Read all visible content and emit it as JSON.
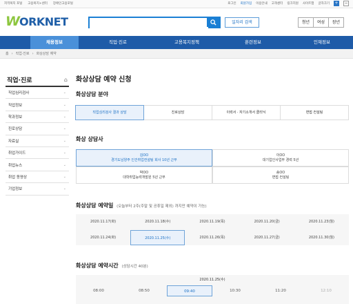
{
  "topbar": {
    "left_links": [
      "지역복지 포털",
      "고용복지+센터",
      "장애인고용포털"
    ],
    "right_links": [
      "로그인",
      "회원가입",
      "이용안내",
      "고객센터",
      "링크지원",
      "사이트맵",
      "글자크기"
    ],
    "zoom_plus": "+",
    "zoom_minus": "−"
  },
  "header": {
    "logo_w": "W",
    "logo_rest": "ORKNET",
    "search_placeholder": "",
    "job_search_label": "일자리 검색",
    "target_buttons": [
      "청년",
      "여성",
      "장년"
    ]
  },
  "gnb": {
    "items": [
      "채용정보",
      "직업·진로",
      "고용복지정책",
      "훈련정보",
      "인재정보"
    ],
    "active_index": 0
  },
  "breadcrumb": {
    "home": "홈",
    "items": [
      "직업·진로",
      "화상상담 예약"
    ]
  },
  "sidebar": {
    "title": "직업·진로",
    "items": [
      "직업심리검사",
      "직업정보",
      "학과정보",
      "진로상담",
      "자료실",
      "취업가이드",
      "취업뉴스",
      "취업 동영상",
      "기업정보"
    ]
  },
  "main": {
    "page_title": "화상상담 예약 신청",
    "field_section": {
      "title": "화상상담 분야",
      "categories": [
        "직업심리검사 결과 상담",
        "진로상담",
        "이력서 · 자기소개서 클리닉",
        "면접 컨설팅"
      ],
      "selected_index": 0
    },
    "counselor_section": {
      "title": "화상 상담사",
      "counselors": [
        {
          "name": "김OO",
          "desc": "경기도남양주 인건취업컨설팅 회사 10년 근무",
          "selected": true
        },
        {
          "name": "이OO",
          "desc": "대기업인사업무 경력 5년",
          "selected": false
        },
        {
          "name": "박OO",
          "desc": "대학취업능력개발원 5년 근무",
          "selected": false
        },
        {
          "name": "송OO",
          "desc": "면접 컨설팅",
          "selected": false
        }
      ]
    },
    "date_section": {
      "title": "화상상담 예약일",
      "subtitle": "(오늘부터 2주(주말 및 공휴일 제외) 까지만 예약이 가능)",
      "dates": [
        "2020.11.17(화)",
        "2020.11.18(수)",
        "2020.11.19(목)",
        "2020.11.20(금)",
        "2020.11.23(월)",
        "2020.11.24(화)",
        "2020.11.25(수)",
        "2020.11.26(목)",
        "2020.11.27(금)",
        "2020.11.30(월)"
      ],
      "selected_index": 6
    },
    "time_section": {
      "title": "화상상담 예약시간",
      "subtitle": "(상담시간 40분)",
      "date_label": "2020.11.25(수)",
      "times": [
        "08:00",
        "08:50",
        "09:40",
        "10:30",
        "11:20",
        "12:10"
      ],
      "selected_index": 2,
      "disabled_indices": [
        5
      ]
    }
  },
  "colors": {
    "brand_blue": "#1e5ba8",
    "accent_blue": "#1a7fd4",
    "logo_green": "#8dc63f",
    "selected_bg": "#e9f1fb",
    "selected_border": "#6ea3d8"
  }
}
